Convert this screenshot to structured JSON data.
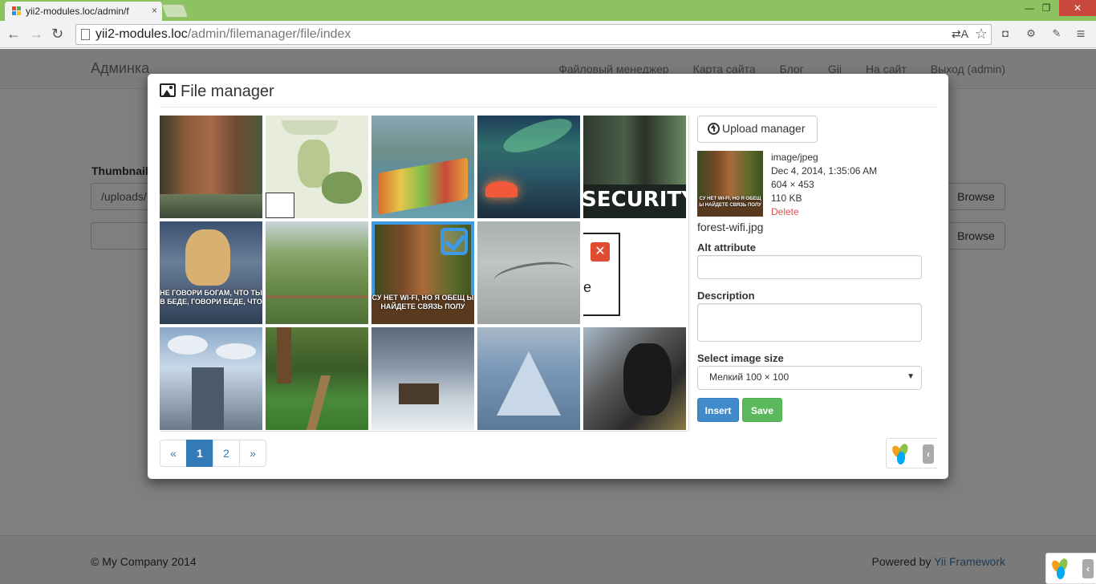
{
  "browser": {
    "tab_title": "yii2-modules.loc/admin/f",
    "url_host": "yii2-modules.loc",
    "url_path": "/admin/filemanager/file/index",
    "tab_close": "×",
    "win_min": "—",
    "win_max": "❐",
    "win_close": "✕",
    "translate": "⇄A",
    "star": "☆",
    "menu": "≡"
  },
  "page": {
    "brand": "Админка",
    "nav": [
      "Файловый менеджер",
      "Карта сайта",
      "Блог",
      "Gii",
      "На сайт",
      "Выход (admin)"
    ],
    "thumbnail_label": "Thumbnail",
    "thumbnail_value": "/uploads/",
    "browse_label": "Browse",
    "footer_left": "© My Company 2014",
    "footer_powered": "Powered by",
    "footer_link": "Yii Framework"
  },
  "modal": {
    "title": "File manager",
    "grid": [
      {
        "id": "sequoia",
        "caption": ""
      },
      {
        "id": "cartoon",
        "caption": ""
      },
      {
        "id": "boat",
        "caption": ""
      },
      {
        "id": "aurora",
        "caption": ""
      },
      {
        "id": "security",
        "caption": "SECURITY FAI"
      },
      {
        "id": "zeus",
        "caption": "НЕ ГОВОРИ БОГАМ, ЧТО ТЫ В БЕДЕ, ГОВОРИ БЕДЕ, ЧТО"
      },
      {
        "id": "meadow",
        "caption": ""
      },
      {
        "id": "forest-wifi",
        "caption": "СУ НЕТ WI-FI, НО Я ОБЕЩ Ы НАЙДЕТЕ СВЯЗЬ ПОЛУ"
      },
      {
        "id": "concrete",
        "caption": ""
      },
      {
        "id": "broken",
        "caption": "e"
      },
      {
        "id": "ufo",
        "caption": ""
      },
      {
        "id": "trail",
        "caption": ""
      },
      {
        "id": "snow",
        "caption": ""
      },
      {
        "id": "pyramid",
        "caption": ""
      },
      {
        "id": "moto",
        "caption": ""
      }
    ],
    "pager": {
      "prev": "«",
      "pages": [
        "1",
        "2"
      ],
      "next": "»",
      "active": "1"
    },
    "upload_label": "Upload manager",
    "file": {
      "mime": "image/jpeg",
      "date": "Dec 4, 2014, 1:35:06 AM",
      "dims": "604 × 453",
      "size": "110 KB",
      "delete": "Delete",
      "name": "forest-wifi.jpg",
      "preview_caption": "СУ НЕТ WI-FI, НО Я ОБЕЩ Ы НАЙДЕТЕ СВЯЗЬ ПОЛУ"
    },
    "alt_label": "Alt attribute",
    "alt_value": "",
    "desc_label": "Description",
    "desc_value": "",
    "size_label": "Select image size",
    "size_value": "Мелкий 100 × 100",
    "insert_label": "Insert",
    "save_label": "Save"
  },
  "colors": {
    "tabbar": "#8cc25f",
    "selection": "#3d9ae8",
    "primary": "#428bca",
    "success": "#5cb85c",
    "danger": "#d9534f",
    "link": "#337ab7"
  }
}
